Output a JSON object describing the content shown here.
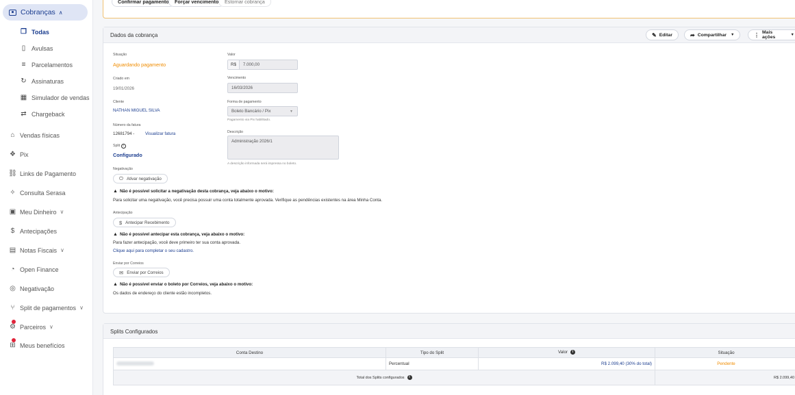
{
  "sidebar": {
    "top": {
      "label": "Cobranças"
    },
    "sub": [
      {
        "label": "Todas",
        "icon": "document-icon"
      },
      {
        "label": "Avulsas",
        "icon": "file-icon"
      },
      {
        "label": "Parcelamentos",
        "icon": "list-icon"
      },
      {
        "label": "Assinaturas",
        "icon": "refresh-icon"
      },
      {
        "label": "Simulador de vendas",
        "icon": "calculator-icon"
      },
      {
        "label": "Chargeback",
        "icon": "swap-icon"
      }
    ],
    "items": [
      {
        "label": "Vendas físicas",
        "icon": "store-icon"
      },
      {
        "label": "Pix",
        "icon": "pix-icon"
      },
      {
        "label": "Links de Pagamento",
        "icon": "link-icon"
      },
      {
        "label": "Consulta Serasa",
        "icon": "sparkle-icon"
      },
      {
        "label": "Meu Dinheiro",
        "icon": "wallet-icon"
      },
      {
        "label": "Antecipações",
        "icon": "dollar-icon"
      },
      {
        "label": "Notas Fiscais",
        "icon": "invoice-icon"
      },
      {
        "label": "Open Finance",
        "icon": "open-finance-icon"
      },
      {
        "label": "Negativação",
        "icon": "negativation-icon"
      },
      {
        "label": "Split de pagamentos",
        "icon": "split-icon"
      },
      {
        "label": "Parceiros",
        "icon": "partners-icon"
      },
      {
        "label": "Meus benefícios",
        "icon": "gift-icon"
      }
    ]
  },
  "top_actions": {
    "confirm": "Confirmar pagamento",
    "force": "Forçar vencimento",
    "reverse": "Estornar cobrança"
  },
  "details": {
    "title": "Dados da cobrança",
    "edit": "Editar",
    "share": "Compartilhar",
    "more": "Mais ações",
    "status_label": "Situação",
    "status_value": "Aguardando pagamento",
    "created_label": "Criado em",
    "created_value": "19/01/2026",
    "client_label": "Cliente",
    "client_value": "NATHAN MIGUEL SILVA",
    "invoice_label": "Número da fatura",
    "invoice_value": "12681794 -",
    "invoice_link": "Visualizar fatura",
    "split_label": "Split",
    "split_value": "Configurado",
    "negativation_label": "Negativação",
    "negativation_button": "Ativar negativação",
    "negativation_warn": "Não é possível solicitar a negativação desta cobrança, veja abaixo o motivo:",
    "negativation_text": "Para solicitar uma negativação, você precisa possuir uma conta totalmente aprovada. Verifique as pendências existentes na área Minha Conta.",
    "antecip_label": "Antecipação",
    "antecip_button": "Antecipar Recebimento",
    "antecip_warn": "Não é possível antecipar esta cobrança, veja abaixo o motivo:",
    "antecip_text": "Para fazer antecipação, você deve primeiro ter sua conta aprovada.",
    "antecip_link": "Clique aqui para completar o seu cadastro.",
    "correios_label": "Enviar por Correios",
    "correios_button": "Enviar por Correios",
    "correios_warn": "Não é possível enviar o boleto por Correios, veja abaixo o motivo:",
    "correios_text": "Os dados de endereço do cliente estão incompletos.",
    "value_label": "Valor",
    "value_prefix": "R$",
    "value_value": "7.000,00",
    "due_label": "Vencimento",
    "due_value": "16/03/2026",
    "payment_label": "Forma de pagamento",
    "payment_value": "Boleto Bancário / Pix",
    "payment_help": "Pagamento via Pix habilitado.",
    "desc_label": "Descrição",
    "desc_value": "Administração 2026/1",
    "desc_help": "A descrição informada será impressa no boleto."
  },
  "splits": {
    "title": "Splits Configurados",
    "headers": [
      "Conta Destino",
      "Tipo do Split",
      "Valor",
      "Situação"
    ],
    "row": {
      "type": "Percentual",
      "value": "R$ 2.099,40 (30% do total)",
      "status": "Pendente"
    },
    "total_label": "Total dos Splits configurados",
    "total_value": "R$ 2.099,40"
  },
  "colors": {
    "accent": "#1b3d8f",
    "status": "#f08c00",
    "warning_border": "#f0c070"
  }
}
